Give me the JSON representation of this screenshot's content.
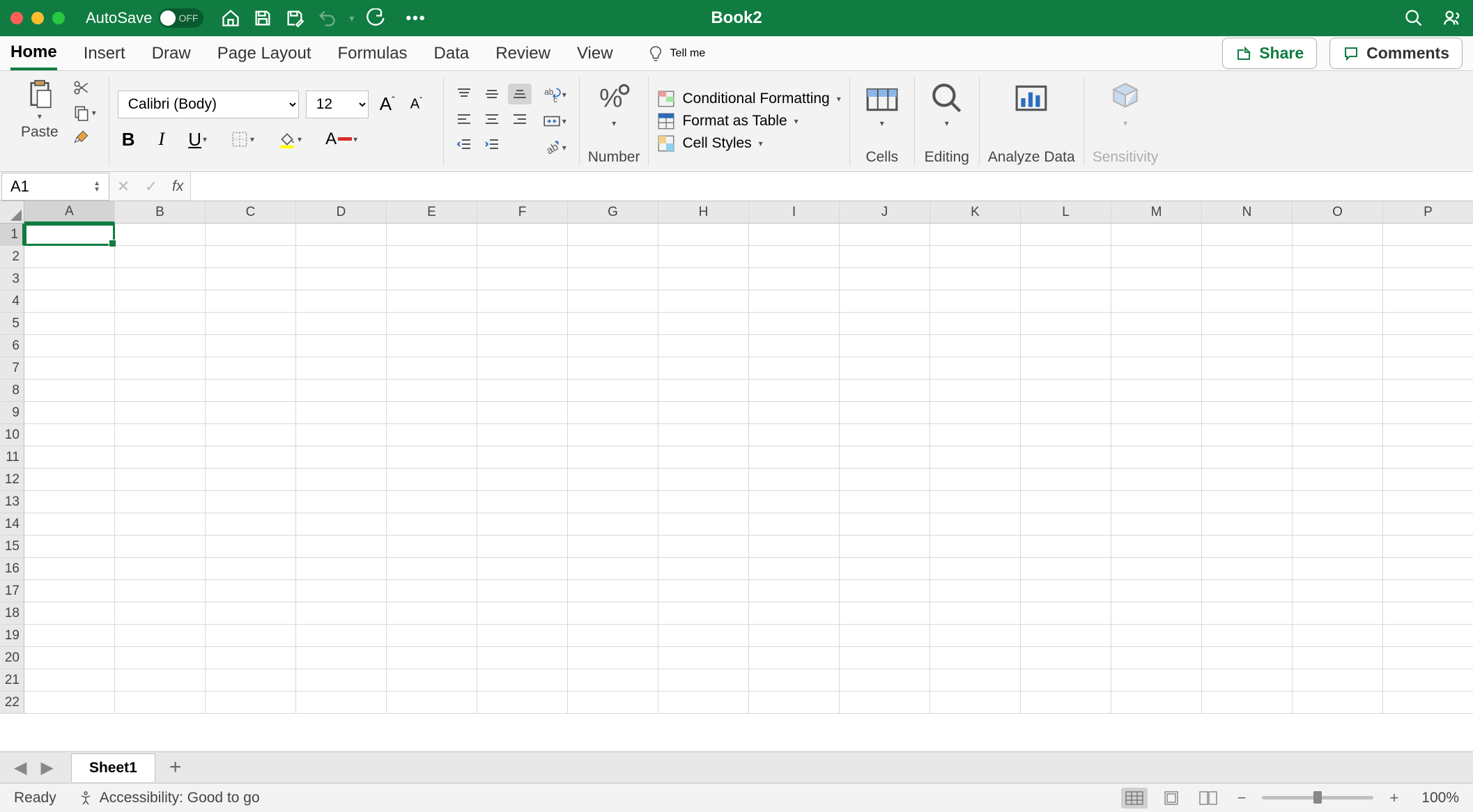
{
  "titlebar": {
    "autosave": "AutoSave",
    "autosave_state": "OFF",
    "title": "Book2"
  },
  "tabs": {
    "home": "Home",
    "insert": "Insert",
    "draw": "Draw",
    "page_layout": "Page Layout",
    "formulas": "Formulas",
    "data": "Data",
    "review": "Review",
    "view": "View",
    "tellme": "Tell me",
    "share": "Share",
    "comments": "Comments"
  },
  "ribbon": {
    "paste": "Paste",
    "font_name": "Calibri (Body)",
    "font_size": "12",
    "number_label": "Number",
    "cond_fmt": "Conditional Formatting",
    "fmt_table": "Format as Table",
    "cell_styles": "Cell Styles",
    "cells": "Cells",
    "editing": "Editing",
    "analyze": "Analyze Data",
    "sensitivity": "Sensitivity"
  },
  "formula_bar": {
    "name_box": "A1",
    "formula": ""
  },
  "grid": {
    "columns": [
      "A",
      "B",
      "C",
      "D",
      "E",
      "F",
      "G",
      "H",
      "I",
      "J",
      "K",
      "L",
      "M",
      "N",
      "O",
      "P"
    ],
    "rows": [
      "1",
      "2",
      "3",
      "4",
      "5",
      "6",
      "7",
      "8",
      "9",
      "10",
      "11",
      "12",
      "13",
      "14",
      "15",
      "16",
      "17",
      "18",
      "19",
      "20",
      "21",
      "22"
    ],
    "selected_cell": "A1"
  },
  "sheets": {
    "active": "Sheet1"
  },
  "statusbar": {
    "mode": "Ready",
    "accessibility": "Accessibility: Good to go",
    "zoom": "100%"
  }
}
